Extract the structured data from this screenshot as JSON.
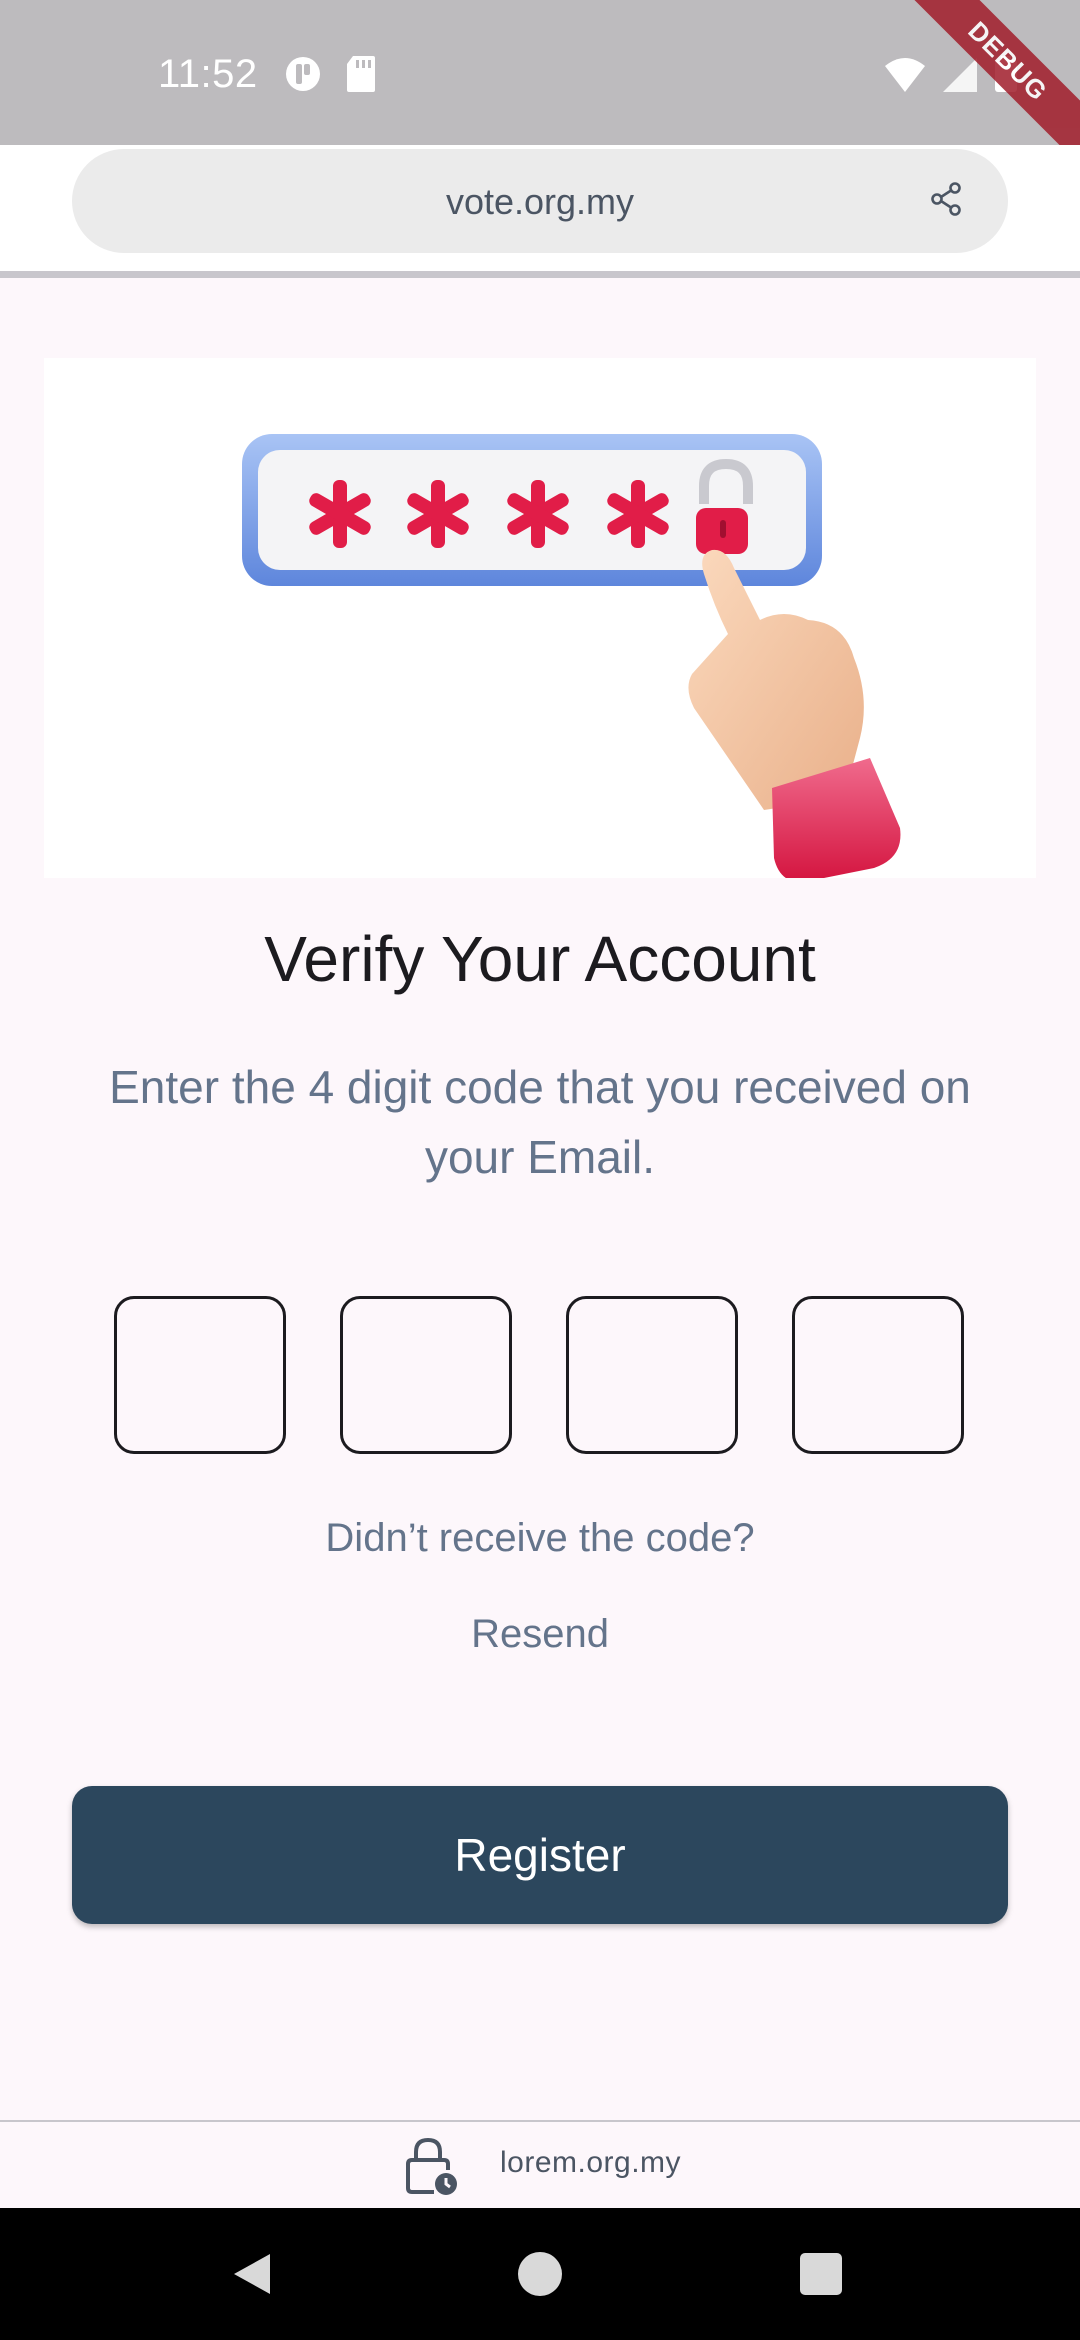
{
  "status_bar": {
    "time": "11:52",
    "left_icons": [
      "app-notification-icon",
      "sd-card-icon"
    ],
    "right_icons": [
      "wifi-icon",
      "cell-signal-icon",
      "battery-icon"
    ],
    "debug_label": "DEBUG"
  },
  "browser": {
    "url": "vote.org.my",
    "share_icon": "share-icon"
  },
  "hero": {
    "image": "password-entry-illustration",
    "mask_char": "✱",
    "mask_count": 4
  },
  "main": {
    "title": "Verify Your Account",
    "subtitle": "Enter the 4 digit code that you received on your Email.",
    "otp_values": [
      "",
      "",
      "",
      ""
    ],
    "resend_question": "Didn’t receive the code?",
    "resend_label": "Resend",
    "register_label": "Register"
  },
  "footer": {
    "domain": "lorem.org.my",
    "lock_icon": "lock-clock-icon"
  },
  "navigation": {
    "back_icon": "back-icon",
    "home_icon": "home-icon",
    "recents_icon": "recents-icon"
  },
  "colors": {
    "primary_button": "#2c475d",
    "muted_text": "#64748b",
    "title_text": "#1c1b1f",
    "accent_red": "#e11d48",
    "debug_banner": "#a11d2b"
  }
}
